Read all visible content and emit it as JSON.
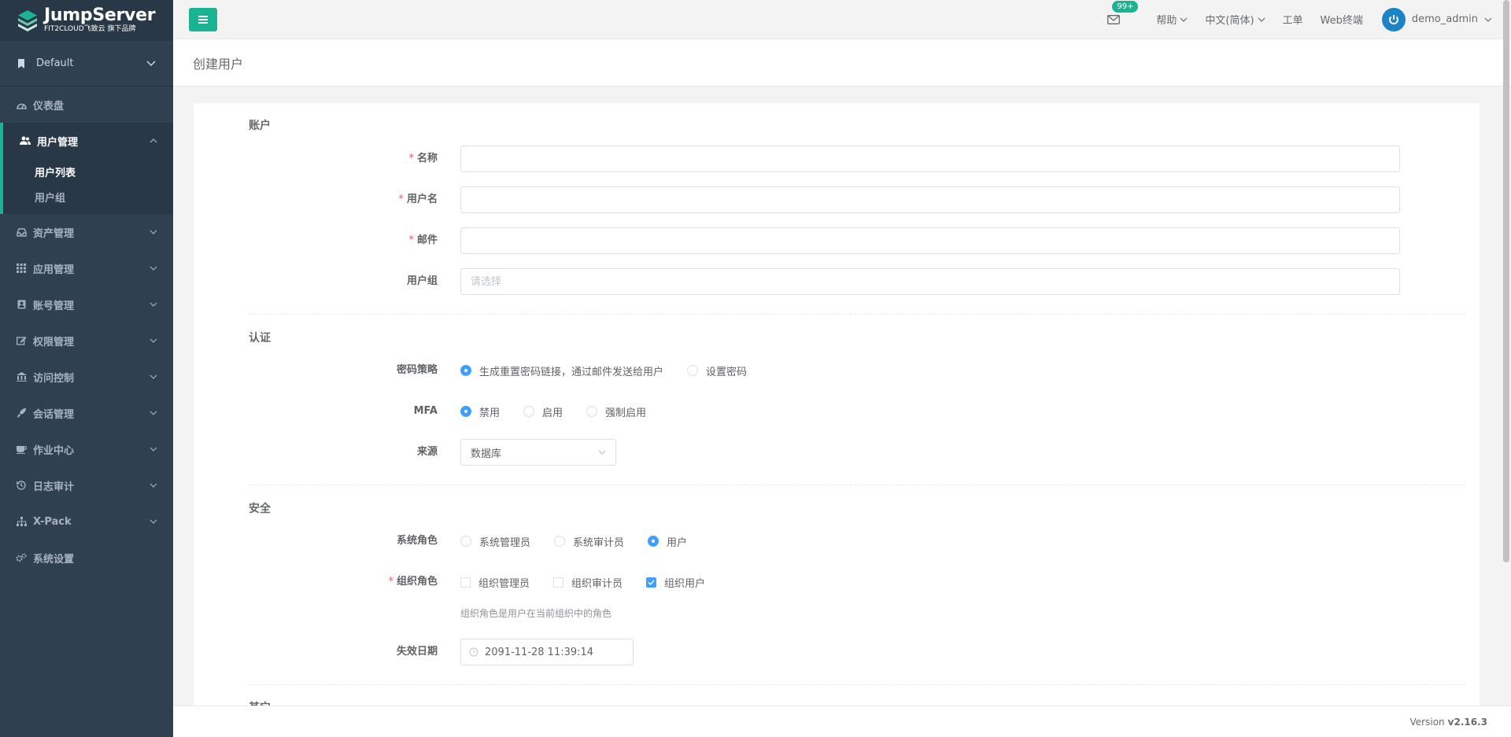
{
  "brand": {
    "name": "JumpServer",
    "sub": "FIT2CLOUD飞致云 旗下品牌"
  },
  "org": {
    "name": "Default"
  },
  "menu": {
    "dashboard": "仪表盘",
    "users": "用户管理",
    "users_sub": [
      "用户列表",
      "用户组"
    ],
    "assets": "资产管理",
    "apps": "应用管理",
    "accounts": "账号管理",
    "perms": "权限管理",
    "acl": "访问控制",
    "sessions": "会话管理",
    "ops": "作业中心",
    "audit": "日志审计",
    "xpack": "X-Pack",
    "settings": "系统设置"
  },
  "topbar": {
    "mail_badge": "99+",
    "help": "帮助",
    "language": "中文(简体)",
    "tickets": "工单",
    "web_terminal": "Web终端",
    "user": "demo_admin"
  },
  "page": {
    "title": "创建用户"
  },
  "form": {
    "account_section": "账户",
    "name_label": "名称",
    "username_label": "用户名",
    "email_label": "邮件",
    "group_label": "用户组",
    "group_placeholder": "请选择",
    "auth_section": "认证",
    "pwd_policy_label": "密码策略",
    "pwd_options": [
      "生成重置密码链接，通过邮件发送给用户",
      "设置密码"
    ],
    "mfa_label": "MFA",
    "mfa_options": [
      "禁用",
      "启用",
      "强制启用"
    ],
    "source_label": "来源",
    "source_value": "数据库",
    "security_section": "安全",
    "sys_role_label": "系统角色",
    "sys_role_options": [
      "系统管理员",
      "系统审计员",
      "用户"
    ],
    "org_role_label": "组织角色",
    "org_role_options": [
      "组织管理员",
      "组织审计员",
      "组织用户"
    ],
    "org_role_hint": "组织角色是用户在当前组织中的角色",
    "expire_label": "失效日期",
    "expire_value": "2091-11-28 11:39:14",
    "other_section": "其它"
  },
  "footer": {
    "version_label": "Version",
    "version": "v2.16.3"
  },
  "colors": {
    "sidebar": "#2f4050",
    "accent": "#1ab394",
    "primary": "#409eff"
  }
}
